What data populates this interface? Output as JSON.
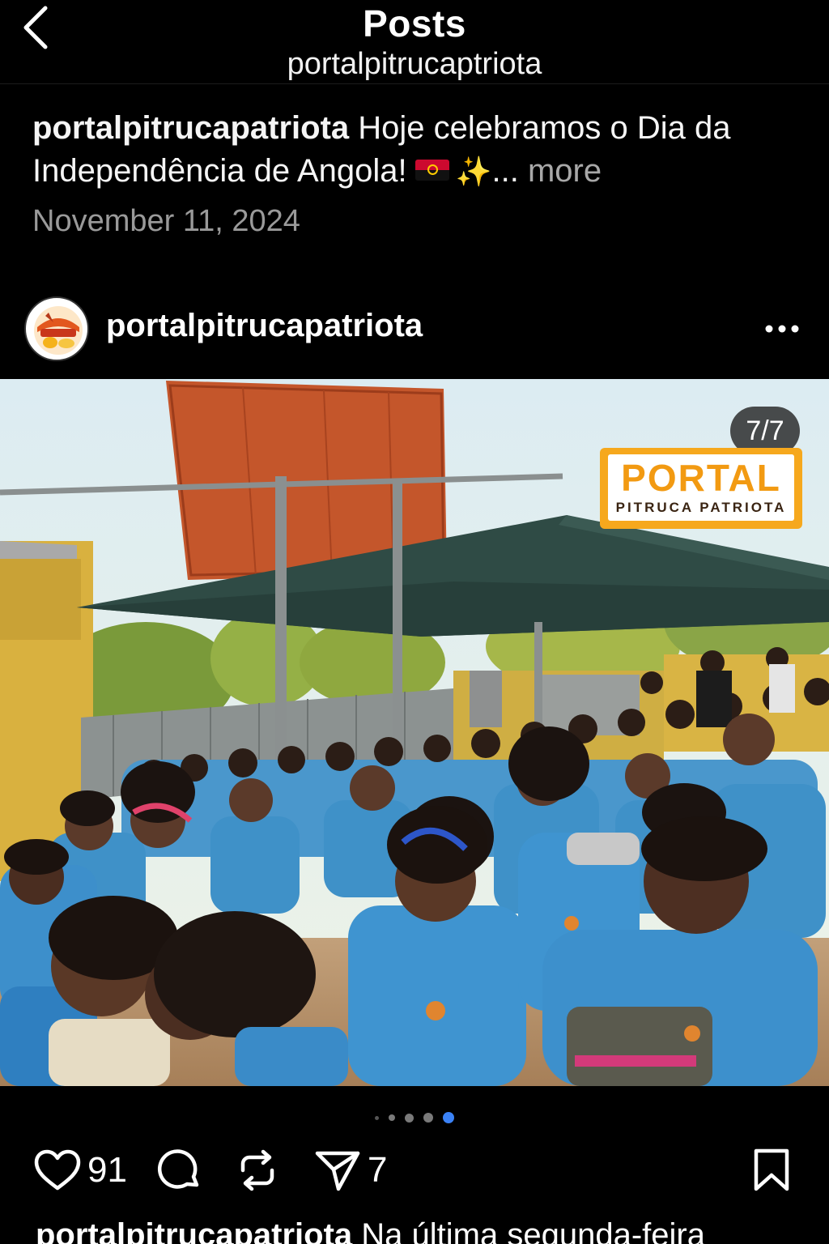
{
  "header": {
    "title": "Posts",
    "subtitle": "portalpitrucaptriota"
  },
  "previous_post": {
    "username": "portalpitrucapatriota",
    "caption_part1": "Hoje celebramos o Dia da Independência de Angola!",
    "caption_ellipsis": "...",
    "more_label": "more",
    "date": "November 11, 2024"
  },
  "post": {
    "username": "portalpitrucapatriota",
    "media_counter": "7/7",
    "watermark": {
      "title": "PORTAL",
      "subtitle": "PITRUCA PATRIOTA"
    },
    "carousel": {
      "total_dots_visible": 5,
      "active_index": 4
    },
    "likes": "91",
    "shares": "7",
    "caption_username": "portalpitrucapatriota",
    "caption_text": "Na última segunda-feira"
  },
  "icons": {
    "back": "chevron-left-icon",
    "more": "more-horizontal-icon",
    "like": "heart-icon",
    "comment": "comment-icon",
    "repost": "repost-icon",
    "share": "send-icon",
    "save": "bookmark-icon"
  },
  "colors": {
    "background": "#000000",
    "muted_text": "#9a9a9a",
    "active_dot": "#3b82f6",
    "watermark_orange": "#f6a81d"
  }
}
